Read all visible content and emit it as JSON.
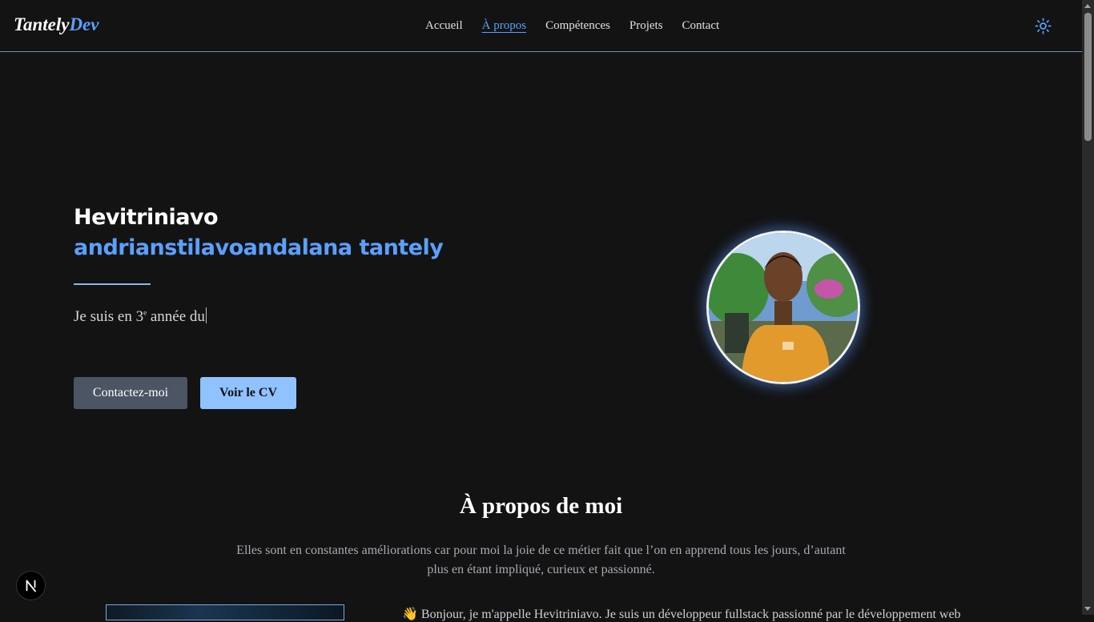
{
  "nav": {
    "brand_part1": "Tantely",
    "brand_part2": "Dev",
    "links": [
      {
        "label": "Accueil"
      },
      {
        "label": "À propos",
        "active": true
      },
      {
        "label": "Compétences"
      },
      {
        "label": "Projets"
      },
      {
        "label": "Contact"
      }
    ],
    "theme_icon": "sun-icon"
  },
  "hero": {
    "name_line1": "Hevitriniavo",
    "name_line2": "andrianstilavoandalana tantely",
    "typed_prefix": "Je suis en 3",
    "typed_sup": "e",
    "typed_suffix": " année du",
    "contact_button": "Contactez-moi",
    "cv_button": "Voir le CV"
  },
  "about": {
    "title": "À propos de moi",
    "text": "Elles sont en constantes améliorations car pour moi la joie de ce métier fait que l’on en apprend tous les jours, d’autant plus en étant impliqué, curieux et passionné.",
    "intro_emoji": "👋",
    "intro": "Bonjour, je m'appelle Hevitriniavo. Je suis un développeur fullstack passionné par le développement web"
  },
  "colors": {
    "background": "#131313",
    "accent": "#5aa0ff",
    "cv_button": "#90c2ff",
    "contact_button": "#4b5563"
  },
  "badge_icon": "nextjs-icon"
}
